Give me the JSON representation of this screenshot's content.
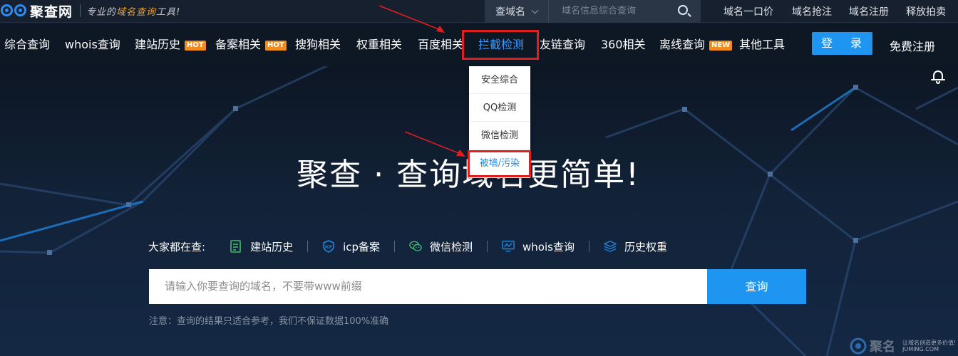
{
  "topbar": {
    "logo_text": "聚查网",
    "slogan_pre": "专业的",
    "slogan_hl": "域名查询",
    "slogan_post": "工具!",
    "search_select": "查域名",
    "search_placeholder": "域名信息综合查询",
    "links": [
      "域名一口价",
      "域名抢注",
      "域名注册",
      "释放拍卖"
    ]
  },
  "nav": {
    "items": [
      {
        "label": "综合查询"
      },
      {
        "label": "whois查询"
      },
      {
        "label": "建站历史",
        "badge": "HOT"
      },
      {
        "label": "备案相关",
        "badge": "HOT"
      },
      {
        "label": "搜狗相关"
      },
      {
        "label": "权重相关"
      },
      {
        "label": "百度相关"
      },
      {
        "label": "拦截检测"
      },
      {
        "label": "友链查询"
      },
      {
        "label": "360相关"
      },
      {
        "label": "离线查询",
        "badge": "NEW"
      },
      {
        "label": "其他工具"
      }
    ],
    "login": "登 录",
    "register": "免费注册"
  },
  "dropdown": {
    "items": [
      "安全综合",
      "QQ检测",
      "微信检测",
      "被墙/污染"
    ]
  },
  "hero": {
    "headline": "聚查 · 查询域名更简单!",
    "popular_label": "大家都在查:",
    "popular": [
      {
        "label": "建站历史",
        "icon": "history-doc-icon",
        "color": "#3cc06a"
      },
      {
        "label": "icp备案",
        "icon": "icp-shield-icon",
        "color": "#1e8ae6"
      },
      {
        "label": "微信检测",
        "icon": "wechat-icon",
        "color": "#3cc06a"
      },
      {
        "label": "whois查询",
        "icon": "monitor-chart-icon",
        "color": "#1e8ae6"
      },
      {
        "label": "历史权重",
        "icon": "layers-icon",
        "color": "#1e8ae6"
      }
    ],
    "search_placeholder": "请输入你要查询的域名，不要带www前缀",
    "search_button": "查询",
    "note": "注意：查询的结果只适合参考，我们不保证数据100%准确"
  },
  "watermark": {
    "text": "聚名",
    "slogan": "让域名创造更多价值!",
    "url": "JUMING.COM"
  }
}
